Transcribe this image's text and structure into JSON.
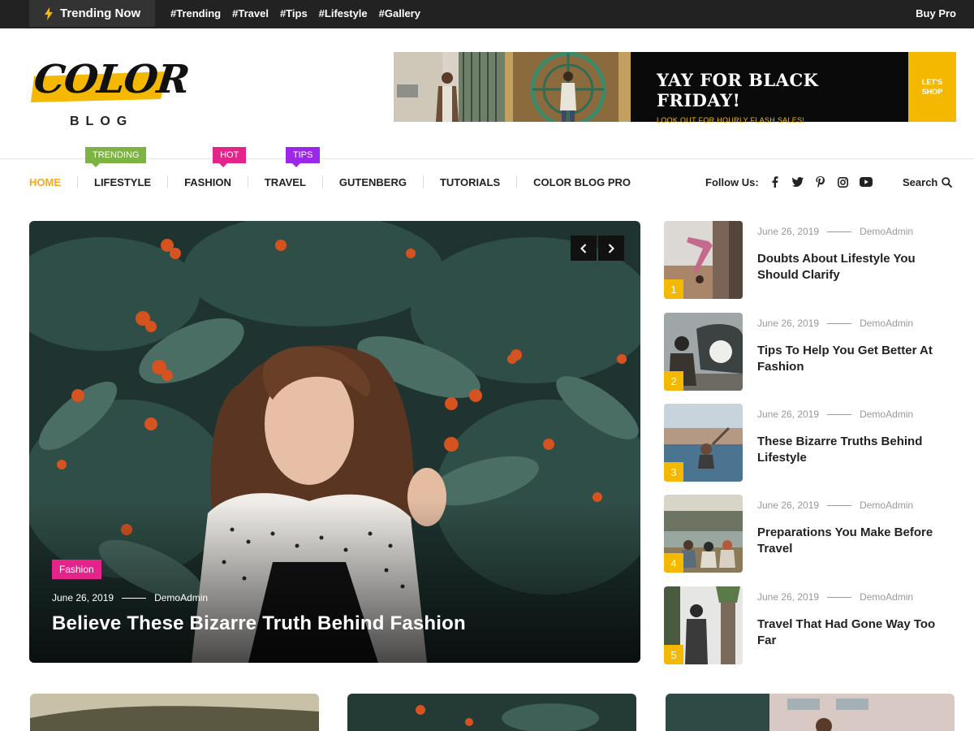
{
  "topbar": {
    "trending_label": "Trending Now",
    "tags": [
      "#Trending",
      "#Travel",
      "#Tips",
      "#Lifestyle",
      "#Gallery"
    ],
    "buy_pro": "Buy Pro"
  },
  "logo": {
    "word": "COLOR",
    "sub": "BLOG"
  },
  "banner": {
    "headline": "YAY FOR BLACK FRIDAY!",
    "subline": "LOOK OUT FOR HOURLY FLASH SALES!",
    "cta_line1": "LET'S",
    "cta_line2": "SHOP"
  },
  "nav": {
    "items": [
      {
        "label": "HOME",
        "active": true
      },
      {
        "label": "LIFESTYLE",
        "badge": "TRENDING",
        "badge_color": "#7cb342"
      },
      {
        "label": "FASHION",
        "badge": "HOT",
        "badge_color": "#e5248b"
      },
      {
        "label": "TRAVEL",
        "badge": "TIPS",
        "badge_color": "#9b27e8"
      },
      {
        "label": "GUTENBERG"
      },
      {
        "label": "TUTORIALS"
      },
      {
        "label": "COLOR BLOG PRO"
      }
    ],
    "follow_label": "Follow Us:",
    "social_icons": [
      "facebook-icon",
      "twitter-icon",
      "pinterest-icon",
      "instagram-icon",
      "youtube-icon"
    ],
    "search_label": "Search"
  },
  "hero": {
    "category": "Fashion",
    "date": "June 26, 2019",
    "author": "DemoAdmin",
    "title": "Believe These Bizarre Truth Behind Fashion"
  },
  "side_posts": [
    {
      "num": "1",
      "date": "June 26, 2019",
      "author": "DemoAdmin",
      "title": "Doubts About Lifestyle You Should Clarify"
    },
    {
      "num": "2",
      "date": "June 26, 2019",
      "author": "DemoAdmin",
      "title": "Tips To Help You Get Better At Fashion"
    },
    {
      "num": "3",
      "date": "June 26, 2019",
      "author": "DemoAdmin",
      "title": "These Bizarre Truths Behind Lifestyle"
    },
    {
      "num": "4",
      "date": "June 26, 2019",
      "author": "DemoAdmin",
      "title": "Preparations You Make Before Travel"
    },
    {
      "num": "5",
      "date": "June 26, 2019",
      "author": "DemoAdmin",
      "title": "Travel That Had Gone Way Too Far"
    }
  ],
  "colors": {
    "accent": "#f5b800",
    "nav_active": "#f5a623",
    "topbar": "#222222",
    "fashion_pink": "#e5248b"
  }
}
